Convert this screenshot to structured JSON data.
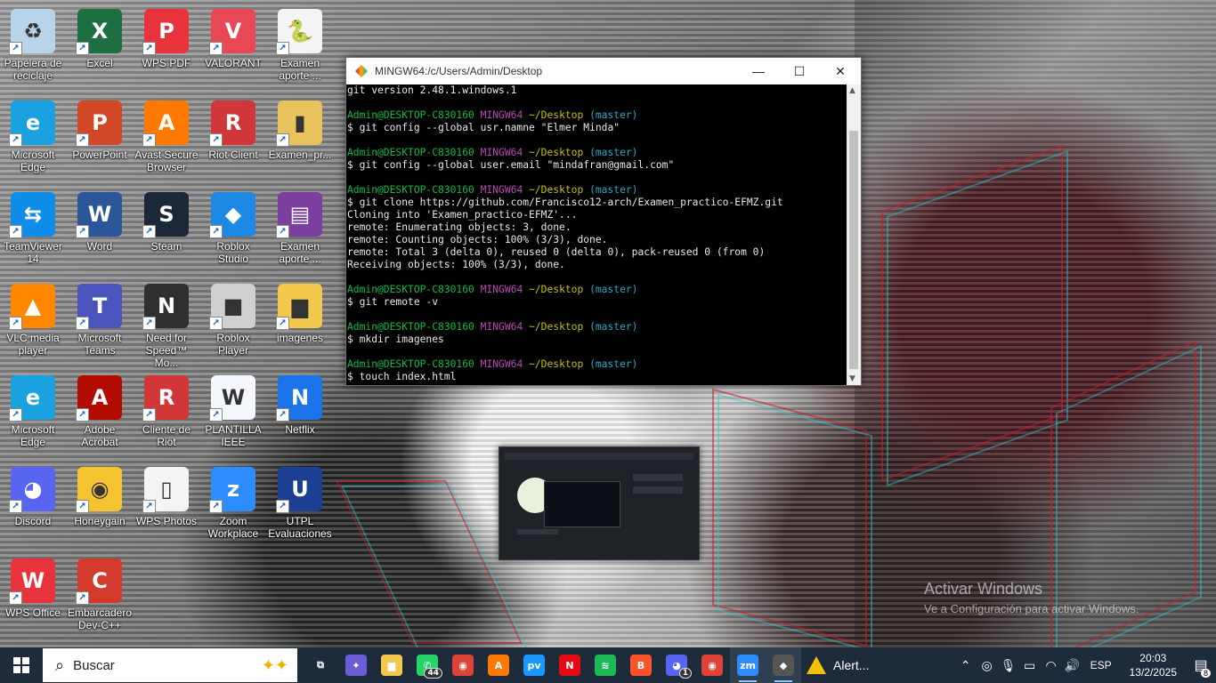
{
  "desktop": {
    "icons": [
      {
        "label": "Papelera de reciclaje",
        "icon": "recycle-bin-icon",
        "color": "#b8d4e8",
        "glyph": "♻"
      },
      {
        "label": "Excel",
        "icon": "excel-icon",
        "color": "#1d6f42",
        "glyph": "X"
      },
      {
        "label": "WPS PDF",
        "icon": "wps-pdf-icon",
        "color": "#e8323c",
        "glyph": "P"
      },
      {
        "label": "VALORANT",
        "icon": "valorant-icon",
        "color": "#e84855",
        "glyph": "V"
      },
      {
        "label": "Examen aporte ...",
        "icon": "python-file-icon",
        "color": "#f4f4f4",
        "glyph": "🐍"
      },
      {
        "label": "Microsoft Edge",
        "icon": "edge-icon",
        "color": "#1aa1e0",
        "glyph": "e"
      },
      {
        "label": "PowerPoint",
        "icon": "powerpoint-icon",
        "color": "#d24726",
        "glyph": "P"
      },
      {
        "label": "Avast Secure Browser",
        "icon": "avast-browser-icon",
        "color": "#ff7800",
        "glyph": "A"
      },
      {
        "label": "Riot Client",
        "icon": "riot-client-icon",
        "color": "#d13639",
        "glyph": "R"
      },
      {
        "label": "Examen_pr...",
        "icon": "folder-zip-icon",
        "color": "#e8c25a",
        "glyph": "▮"
      },
      {
        "label": "TeamViewer 14",
        "icon": "teamviewer-icon",
        "color": "#0e8ee9",
        "glyph": "⇆"
      },
      {
        "label": "Word",
        "icon": "word-icon",
        "color": "#2b579a",
        "glyph": "W"
      },
      {
        "label": "Steam",
        "icon": "steam-icon",
        "color": "#1b2838",
        "glyph": "S"
      },
      {
        "label": "Roblox Studio",
        "icon": "roblox-studio-icon",
        "color": "#1e88e5",
        "glyph": "◆"
      },
      {
        "label": "Examen aporte ...",
        "icon": "winrar-icon",
        "color": "#7b3fa0",
        "glyph": "▤"
      },
      {
        "label": "VLC media player",
        "icon": "vlc-icon",
        "color": "#ff8800",
        "glyph": "▲"
      },
      {
        "label": "Microsoft Teams",
        "icon": "teams-icon",
        "color": "#4b53bc",
        "glyph": "T"
      },
      {
        "label": "Need for Speed™ Mo...",
        "icon": "nfs-icon",
        "color": "#2f2f2f",
        "glyph": "N"
      },
      {
        "label": "Roblox Player",
        "icon": "roblox-player-icon",
        "color": "#d0d0d0",
        "glyph": "■"
      },
      {
        "label": "imagenes",
        "icon": "folder-icon",
        "color": "#f2c94c",
        "glyph": "▆"
      },
      {
        "label": "Microsoft Edge",
        "icon": "edge-icon",
        "color": "#1aa1e0",
        "glyph": "e"
      },
      {
        "label": "Adobe Acrobat",
        "icon": "acrobat-icon",
        "color": "#b30b00",
        "glyph": "A"
      },
      {
        "label": "Cliente de Riot",
        "icon": "riot-client-icon",
        "color": "#d13639",
        "glyph": "R"
      },
      {
        "label": "PLANTILLA IEEE",
        "icon": "word-document-icon",
        "color": "#f4f7fb",
        "glyph": "W"
      },
      {
        "label": "Netflix",
        "icon": "netflix-icon",
        "color": "#1a73e8",
        "glyph": "N"
      },
      {
        "label": "Discord",
        "icon": "discord-icon",
        "color": "#5865f2",
        "glyph": "◕"
      },
      {
        "label": "Honeygain",
        "icon": "honeygain-icon",
        "color": "#f4c430",
        "glyph": "◉"
      },
      {
        "label": "WPS Photos",
        "icon": "wps-photos-icon",
        "color": "#f4f4f4",
        "glyph": "▯"
      },
      {
        "label": "Zoom Workplace",
        "icon": "zoom-icon",
        "color": "#2d8cff",
        "glyph": "z"
      },
      {
        "label": "UTPL Evaluaciones",
        "icon": "utpl-icon",
        "color": "#1c3f94",
        "glyph": "U"
      },
      {
        "label": "WPS Office",
        "icon": "wps-office-icon",
        "color": "#e8323c",
        "glyph": "W"
      },
      {
        "label": "Embarcadero Dev-C++",
        "icon": "devcpp-icon",
        "color": "#d33a2c",
        "glyph": "C"
      }
    ]
  },
  "terminal": {
    "title": "MINGW64:/c/Users/Admin/Desktop",
    "lines": [
      [
        {
          "t": "git version 2.48.1.windows.1",
          "c": "white"
        }
      ],
      [
        {
          "t": "",
          "c": "white"
        }
      ],
      [
        {
          "t": "Admin@DESKTOP-C830160 ",
          "c": "green"
        },
        {
          "t": "MINGW64 ",
          "c": "magenta"
        },
        {
          "t": "~/Desktop ",
          "c": "yellow"
        },
        {
          "t": "(master)",
          "c": "cyan"
        }
      ],
      [
        {
          "t": "$ git config --global usr.namne \"Elmer Minda\"",
          "c": "white"
        }
      ],
      [
        {
          "t": "",
          "c": "white"
        }
      ],
      [
        {
          "t": "Admin@DESKTOP-C830160 ",
          "c": "green"
        },
        {
          "t": "MINGW64 ",
          "c": "magenta"
        },
        {
          "t": "~/Desktop ",
          "c": "yellow"
        },
        {
          "t": "(master)",
          "c": "cyan"
        }
      ],
      [
        {
          "t": "$ git config --global user.email \"mindafran@gmail.com\"",
          "c": "white"
        }
      ],
      [
        {
          "t": "",
          "c": "white"
        }
      ],
      [
        {
          "t": "Admin@DESKTOP-C830160 ",
          "c": "green"
        },
        {
          "t": "MINGW64 ",
          "c": "magenta"
        },
        {
          "t": "~/Desktop ",
          "c": "yellow"
        },
        {
          "t": "(master)",
          "c": "cyan"
        }
      ],
      [
        {
          "t": "$ git clone https://github.com/Francisco12-arch/Examen_practico-EFMZ.git",
          "c": "white"
        }
      ],
      [
        {
          "t": "Cloning into 'Examen_practico-EFMZ'...",
          "c": "white"
        }
      ],
      [
        {
          "t": "remote: Enumerating objects: 3, done.",
          "c": "white"
        }
      ],
      [
        {
          "t": "remote: Counting objects: 100% (3/3), done.",
          "c": "white"
        }
      ],
      [
        {
          "t": "remote: Total 3 (delta 0), reused 0 (delta 0), pack-reused 0 (from 0)",
          "c": "white"
        }
      ],
      [
        {
          "t": "Receiving objects: 100% (3/3), done.",
          "c": "white"
        }
      ],
      [
        {
          "t": "",
          "c": "white"
        }
      ],
      [
        {
          "t": "Admin@DESKTOP-C830160 ",
          "c": "green"
        },
        {
          "t": "MINGW64 ",
          "c": "magenta"
        },
        {
          "t": "~/Desktop ",
          "c": "yellow"
        },
        {
          "t": "(master)",
          "c": "cyan"
        }
      ],
      [
        {
          "t": "$ git remote -v",
          "c": "white"
        }
      ],
      [
        {
          "t": "",
          "c": "white"
        }
      ],
      [
        {
          "t": "Admin@DESKTOP-C830160 ",
          "c": "green"
        },
        {
          "t": "MINGW64 ",
          "c": "magenta"
        },
        {
          "t": "~/Desktop ",
          "c": "yellow"
        },
        {
          "t": "(master)",
          "c": "cyan"
        }
      ],
      [
        {
          "t": "$ mkdir imagenes",
          "c": "white"
        }
      ],
      [
        {
          "t": "",
          "c": "white"
        }
      ],
      [
        {
          "t": "Admin@DESKTOP-C830160 ",
          "c": "green"
        },
        {
          "t": "MINGW64 ",
          "c": "magenta"
        },
        {
          "t": "~/Desktop ",
          "c": "yellow"
        },
        {
          "t": "(master)",
          "c": "cyan"
        }
      ],
      [
        {
          "t": "$ touch index.html",
          "c": "white"
        }
      ]
    ]
  },
  "watermark": {
    "line1": "Activar Windows",
    "line2": "Ve a Configuración para activar Windows."
  },
  "taskbar": {
    "search_placeholder": "Buscar",
    "apps": [
      {
        "name": "task-view",
        "icon": "task-view-icon",
        "glyph": "⧉",
        "color": "#1e2b3a"
      },
      {
        "name": "copilot",
        "icon": "copilot-icon",
        "glyph": "✦",
        "color": "#6b5bd6"
      },
      {
        "name": "file-explorer",
        "icon": "file-explorer-icon",
        "glyph": "▆",
        "color": "#f2c94c"
      },
      {
        "name": "whatsapp",
        "icon": "whatsapp-icon",
        "glyph": "✆",
        "color": "#25d366",
        "badge": "44"
      },
      {
        "name": "chrome",
        "icon": "chrome-icon",
        "glyph": "◉",
        "color": "#db4437"
      },
      {
        "name": "avast-browser",
        "icon": "avast-browser-icon",
        "glyph": "A",
        "color": "#ff7800"
      },
      {
        "name": "prime-video",
        "icon": "prime-video-icon",
        "glyph": "pv",
        "color": "#1a98ff"
      },
      {
        "name": "netflix",
        "icon": "netflix-icon",
        "glyph": "N",
        "color": "#e50914"
      },
      {
        "name": "spotify",
        "icon": "spotify-icon",
        "glyph": "≋",
        "color": "#1db954"
      },
      {
        "name": "brave",
        "icon": "brave-icon",
        "glyph": "B",
        "color": "#fb542b"
      },
      {
        "name": "discord",
        "icon": "discord-icon",
        "glyph": "◕",
        "color": "#5865f2",
        "badge": "1"
      },
      {
        "name": "chrome-profile",
        "icon": "chrome-icon",
        "glyph": "◉",
        "color": "#db4437"
      },
      {
        "name": "zoom",
        "icon": "zoom-icon",
        "glyph": "zm",
        "color": "#2d8cff",
        "active": true
      },
      {
        "name": "git-bash",
        "icon": "git-bash-icon",
        "glyph": "◆",
        "color": "#555",
        "active": true
      }
    ],
    "alert_label": "Alert...",
    "tray": {
      "language": "ESP",
      "time": "20:03",
      "date": "13/2/2025",
      "notifications": "8"
    }
  }
}
